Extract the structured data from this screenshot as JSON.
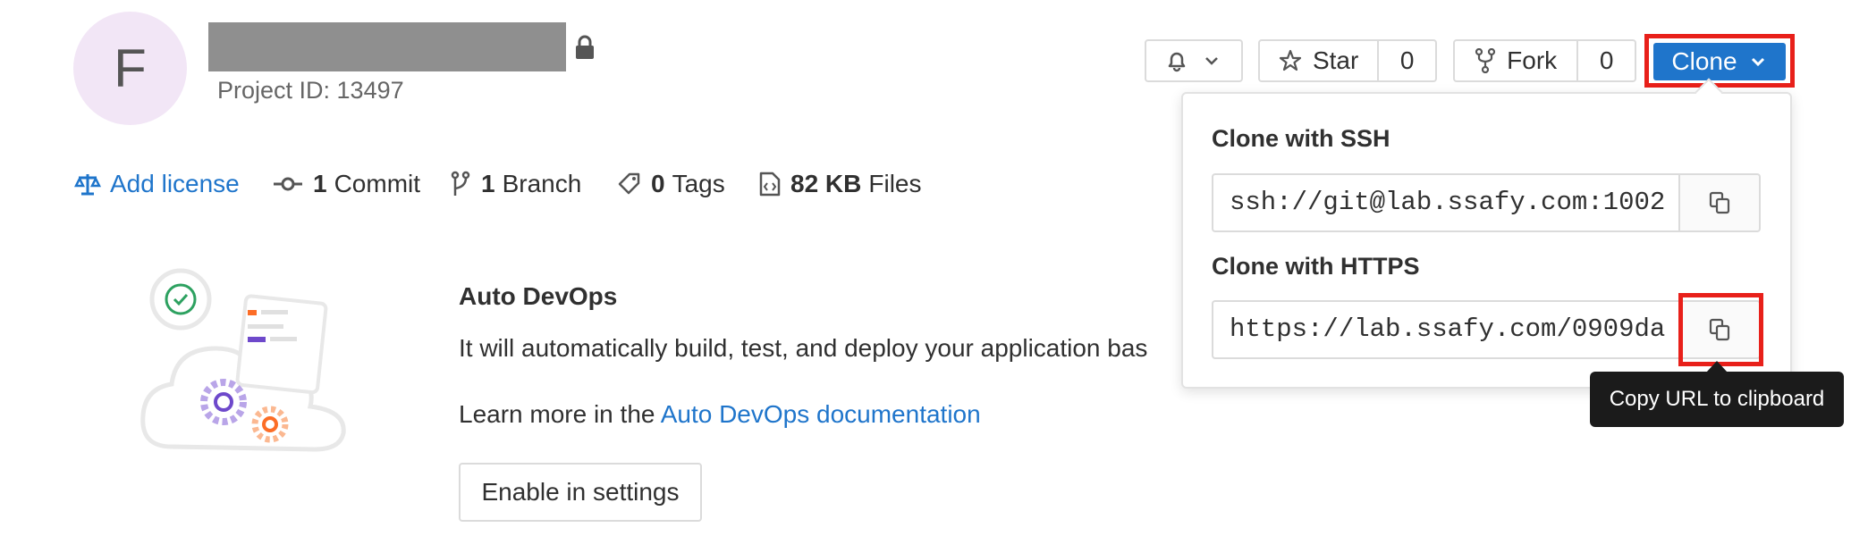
{
  "project": {
    "avatar_letter": "F",
    "project_id": "Project ID: 13497"
  },
  "stats": {
    "license": "Add license",
    "commits_count": "1",
    "commits_label": "Commit",
    "branches_count": "1",
    "branches_label": "Branch",
    "tags_count": "0",
    "tags_label": "Tags",
    "files_size": "82 KB",
    "files_label": "Files"
  },
  "actions": {
    "star_label": "Star",
    "star_count": "0",
    "fork_label": "Fork",
    "fork_count": "0",
    "clone_label": "Clone"
  },
  "clone_dropdown": {
    "ssh_title": "Clone with SSH",
    "ssh_url": "ssh://git@lab.ssafy.com:1002",
    "https_title": "Clone with HTTPS",
    "https_url": "https://lab.ssafy.com/0909da",
    "tooltip": "Copy URL to clipboard"
  },
  "auto_devops": {
    "title": "Auto DevOps",
    "description": "It will automatically build, test, and deploy your application bas",
    "learn_prefix": "Learn more in the",
    "learn_link": "Auto DevOps documentation",
    "enable_button": "Enable in settings"
  },
  "colors": {
    "accent": "#1f75cb",
    "highlight": "#e8201a",
    "tooltip_bg": "#1b1b1b"
  }
}
